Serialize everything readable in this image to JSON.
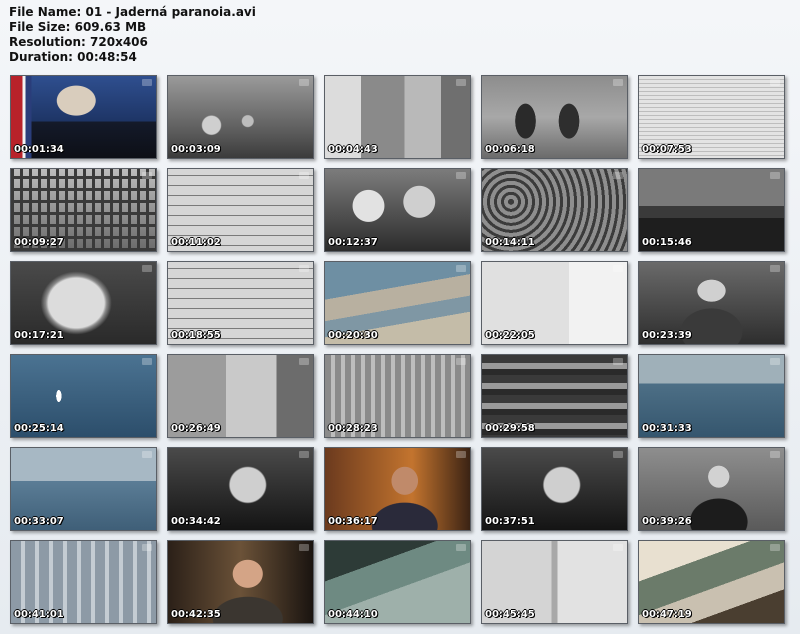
{
  "file_info": {
    "name_line": "File Name: 01 - Jaderná paranoia.avi",
    "size_line": "File Size: 609.63 MB",
    "resolution_line": "Resolution: 720x406",
    "duration_line": "Duration: 00:48:54"
  },
  "thumbnails": [
    {
      "time": "00:01:34",
      "scene": "speaker-podium-flag"
    },
    {
      "time": "00:03:09",
      "scene": "lab-machinery"
    },
    {
      "time": "00:04:43",
      "scene": "office-workers"
    },
    {
      "time": "00:06:18",
      "scene": "officials-standing"
    },
    {
      "time": "00:07:53",
      "scene": "newspaper-headline"
    },
    {
      "time": "00:09:27",
      "scene": "prison-bars"
    },
    {
      "time": "00:11:02",
      "scene": "typed-document"
    },
    {
      "time": "00:12:37",
      "scene": "couple-portrait"
    },
    {
      "time": "00:14:11",
      "scene": "crowd-gathering"
    },
    {
      "time": "00:15:46",
      "scene": "conference-table"
    },
    {
      "time": "00:17:21",
      "scene": "smiling-woman"
    },
    {
      "time": "00:18:55",
      "scene": "typed-document"
    },
    {
      "time": "00:20:30",
      "scene": "aerial-coast"
    },
    {
      "time": "00:22:05",
      "scene": "document-map"
    },
    {
      "time": "00:23:39",
      "scene": "khrushchev-speaking"
    },
    {
      "time": "00:25:14",
      "scene": "missile-launch"
    },
    {
      "time": "00:26:49",
      "scene": "office-interior"
    },
    {
      "time": "00:28:23",
      "scene": "aerial-base"
    },
    {
      "time": "00:29:58",
      "scene": "industrial-pipes"
    },
    {
      "time": "00:31:33",
      "scene": "ocean-ship"
    },
    {
      "time": "00:33:07",
      "scene": "sea-vessel"
    },
    {
      "time": "00:34:42",
      "scene": "kennedy-portrait"
    },
    {
      "time": "00:36:17",
      "scene": "interview-man-glasses"
    },
    {
      "time": "00:37:51",
      "scene": "kennedy-portrait"
    },
    {
      "time": "00:39:26",
      "scene": "official-microphones"
    },
    {
      "time": "00:41:01",
      "scene": "airfield-planes"
    },
    {
      "time": "00:42:35",
      "scene": "interview-older-man"
    },
    {
      "time": "00:44:10",
      "scene": "aerial-building"
    },
    {
      "time": "00:45:45",
      "scene": "papers-table"
    },
    {
      "time": "00:47:19",
      "scene": "wreckage"
    }
  ],
  "colors": {
    "background_top": "#f4f6f9",
    "background_bottom": "#e6ebf0",
    "thumb_border": "#5a5f66",
    "timestamp_text": "#ffffff"
  }
}
